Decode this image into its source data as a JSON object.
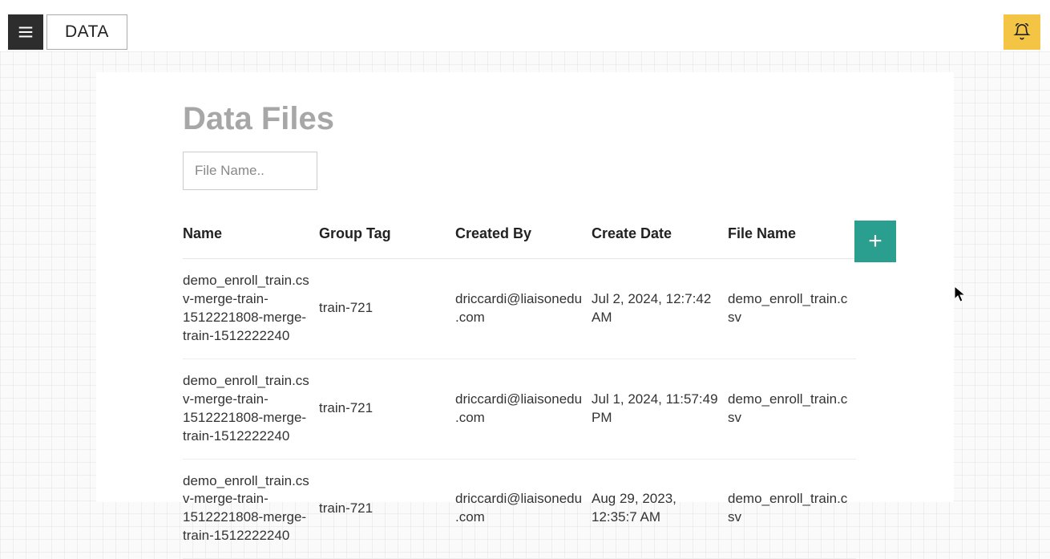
{
  "header": {
    "breadcrumb": "DATA"
  },
  "page": {
    "title": "Data Files"
  },
  "search": {
    "placeholder": "File Name.."
  },
  "table": {
    "columns": [
      "Name",
      "Group Tag",
      "Created By",
      "Create Date",
      "File Name"
    ],
    "rows": [
      {
        "name": "demo_enroll_train.csv-merge-train-1512221808-merge-train-1512222240",
        "group_tag": "train-721",
        "created_by": "driccardi@liaisonedu.com",
        "create_date": "Jul 2, 2024, 12:7:42 AM",
        "file_name": "demo_enroll_train.csv"
      },
      {
        "name": "demo_enroll_train.csv-merge-train-1512221808-merge-train-1512222240",
        "group_tag": "train-721",
        "created_by": "driccardi@liaisonedu.com",
        "create_date": "Jul 1, 2024, 11:57:49 PM",
        "file_name": "demo_enroll_train.csv"
      },
      {
        "name": "demo_enroll_train.csv-merge-train-1512221808-merge-train-1512222240",
        "group_tag": "train-721",
        "created_by": "driccardi@liaisonedu.com",
        "create_date": "Aug 29, 2023, 12:35:7 AM",
        "file_name": "demo_enroll_train.csv"
      }
    ]
  },
  "buttons": {
    "add": "+"
  }
}
